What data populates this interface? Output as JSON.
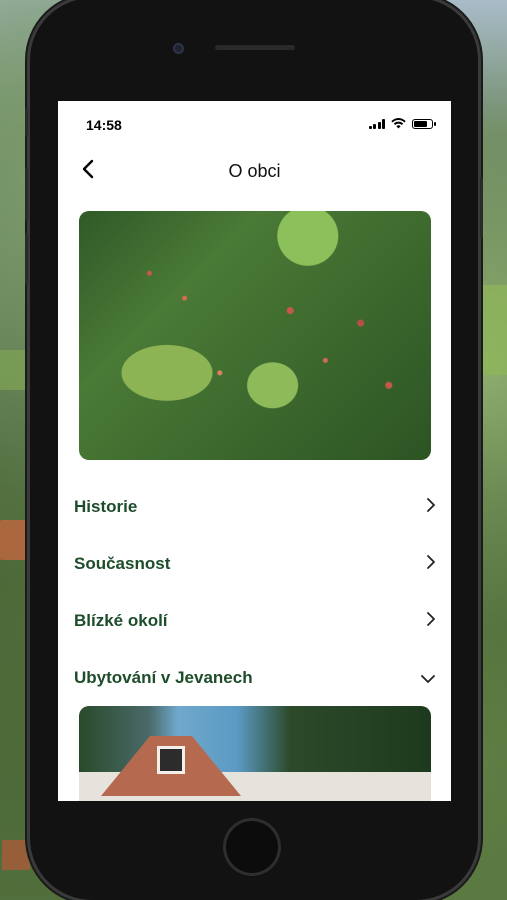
{
  "status_bar": {
    "time": "14:58"
  },
  "header": {
    "back_icon": "chevron-left-icon",
    "title": "O obci"
  },
  "hero_image": {
    "description_icon": "aerial-village-photo"
  },
  "menu": {
    "items": [
      {
        "label": "Historie",
        "icon": "chevron-right-icon"
      },
      {
        "label": "Současnost",
        "icon": "chevron-right-icon"
      },
      {
        "label": "Blízké okolí",
        "icon": "chevron-right-icon"
      },
      {
        "label": "Ubytování v Jevanech",
        "icon": "chevron-down-icon"
      }
    ]
  },
  "colors": {
    "accent": "#1e4d2b",
    "background": "#ffffff",
    "phone_frame": "#121212"
  }
}
